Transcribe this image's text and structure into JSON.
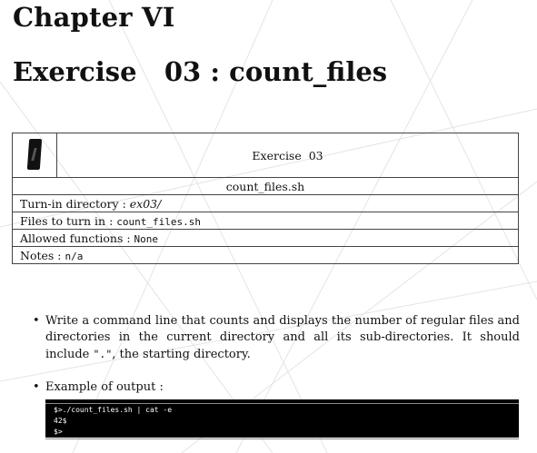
{
  "chapter": "Chapter VI",
  "exercise": {
    "label": "Exercise",
    "number": "03",
    "separator": ":",
    "name": "count_files"
  },
  "table": {
    "header": "Exercise  03",
    "filename": "count_files.sh",
    "rows": [
      {
        "label": "Turn-in directory : ",
        "value": "ex03/"
      },
      {
        "label": "Files to turn in : ",
        "value": "count_files.sh"
      },
      {
        "label": "Allowed functions : ",
        "value": "None"
      },
      {
        "label": "Notes : ",
        "value": "n/a"
      }
    ]
  },
  "instructions": {
    "bullet1": {
      "before": "Write a command line that counts and displays the number of regular files and directories in the current directory and all its sub-directories. It should include ",
      "code": "\".\"",
      "after": ", the starting directory."
    },
    "bullet2": "Example of output :"
  },
  "terminal": {
    "lines": [
      "$>./count_files.sh | cat -e",
      "42$",
      "$>"
    ]
  }
}
